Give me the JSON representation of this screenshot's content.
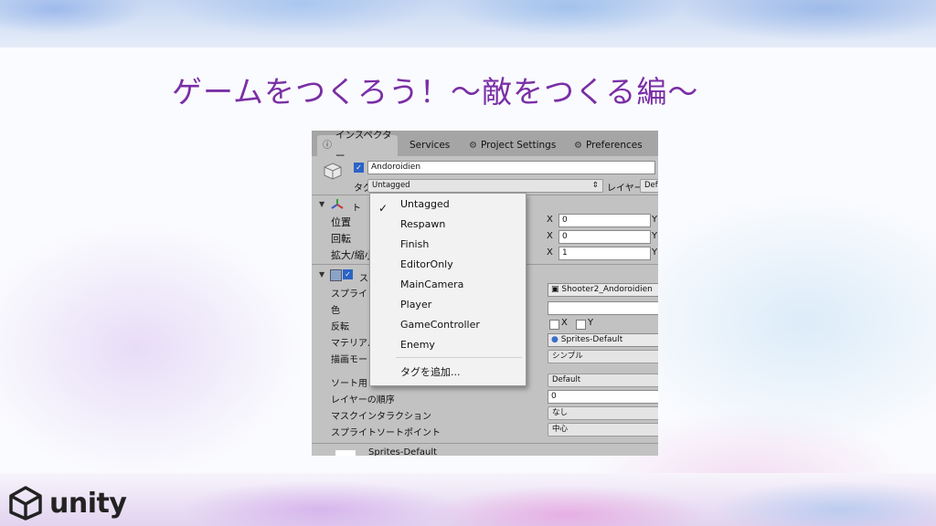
{
  "slide": {
    "title": "ゲームをつくろう！〜敵をつくる編〜",
    "brand": "unity",
    "title_color": "#7a2fa5"
  },
  "tabs": [
    {
      "label": "インスペクター",
      "icon": "info-icon"
    },
    {
      "label": "Services",
      "icon": ""
    },
    {
      "label": "Project Settings",
      "icon": "gear-icon"
    },
    {
      "label": "Preferences",
      "icon": "gear-icon"
    }
  ],
  "object": {
    "name": "Andoroidien",
    "tag_label": "タグ",
    "tag_value": "Untagged",
    "layer_label": "レイヤー",
    "layer_value": "Def"
  },
  "transform": {
    "header": "ト",
    "position_label": "位置",
    "rotation_label": "回転",
    "scale_label": "拡大/縮小",
    "x_label": "X",
    "y_label": "Y",
    "position_x": "0",
    "rotation_x": "0",
    "scale_x": "1"
  },
  "sprite_renderer": {
    "header": "ス",
    "sprite_label": "スプライト",
    "sprite_value": "Shooter2_Andoroidien",
    "color_label": "色",
    "flip_label": "反転",
    "flip_x": "X",
    "flip_y": "Y",
    "material_label": "マテリアル",
    "material_value": "Sprites-Default",
    "draw_mode_label": "描画モード",
    "draw_mode_value": "シンプル",
    "sorting_layer_label": "ソート用レ",
    "sorting_layer_value": "Default",
    "order_label": "レイヤーの順序",
    "order_value": "0",
    "mask_label": "マスクインタラクション",
    "mask_value": "なし",
    "sort_point_label": "スプライトソートポイント",
    "sort_point_value": "中心",
    "footer_label": "Sprites-Default"
  },
  "tag_menu": {
    "items": [
      "Untagged",
      "Respawn",
      "Finish",
      "EditorOnly",
      "MainCamera",
      "Player",
      "GameController",
      "Enemy"
    ],
    "selected": "Untagged",
    "add_label": "タグを追加..."
  }
}
